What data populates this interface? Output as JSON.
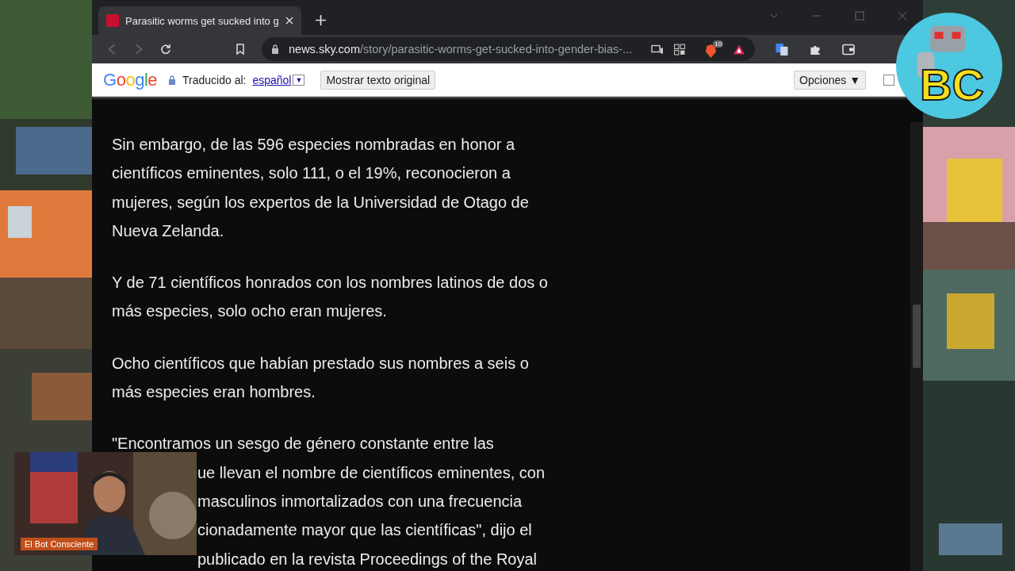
{
  "browser": {
    "tab": {
      "title": "Parasitic worms get sucked into g",
      "selected": true
    },
    "url": {
      "host": "news.sky.com",
      "path": "/story/parasitic-worms-get-sucked-into-gender-bias-..."
    },
    "back": {
      "disabled": true
    },
    "forward": {
      "disabled": true
    },
    "shield_badge": "10"
  },
  "translate_bar": {
    "logo": "Google",
    "label": "Traducido al:",
    "language": "español",
    "dropdown": "▼",
    "show_original": "Mostrar texto original",
    "options": "Opciones ▼"
  },
  "article": {
    "paragraphs": [
      {
        "lines": [
          {
            "kind": "full",
            "text": "Sin embargo, de las 596 especies nombradas en honor a"
          },
          {
            "kind": "full",
            "text": "científicos eminentes, solo 111, o el 19%, reconocieron a"
          },
          {
            "kind": "full",
            "text": "mujeres, según los expertos de la Universidad de Otago de"
          },
          {
            "kind": "full",
            "text": "Nueva Zelanda."
          }
        ]
      },
      {
        "lines": [
          {
            "kind": "full",
            "text": "Y de 71 científicos honrados con los nombres latinos de dos o"
          },
          {
            "kind": "full",
            "text": "más especies, solo ocho eran mujeres."
          }
        ]
      },
      {
        "lines": [
          {
            "kind": "full",
            "text": "Ocho científicos que habían prestado sus nombres a seis o"
          },
          {
            "kind": "full",
            "text": "más especies eran hombres."
          }
        ]
      },
      {
        "lines": [
          {
            "kind": "full",
            "text": "\"Encontramos un sesgo de género constante entre las"
          },
          {
            "kind": "cut",
            "text": "ue llevan el nombre de científicos eminentes, con"
          },
          {
            "kind": "cut",
            "text": "masculinos inmortalizados con una frecuencia"
          },
          {
            "kind": "cut",
            "text": "cionadamente mayor que las científicas\", dijo el"
          },
          {
            "kind": "cut",
            "text": "publicado en la revista Proceedings of the Royal"
          }
        ]
      }
    ]
  },
  "webcam": {
    "caption": "El Bot Consciente"
  },
  "logo": {
    "text": "BC"
  }
}
